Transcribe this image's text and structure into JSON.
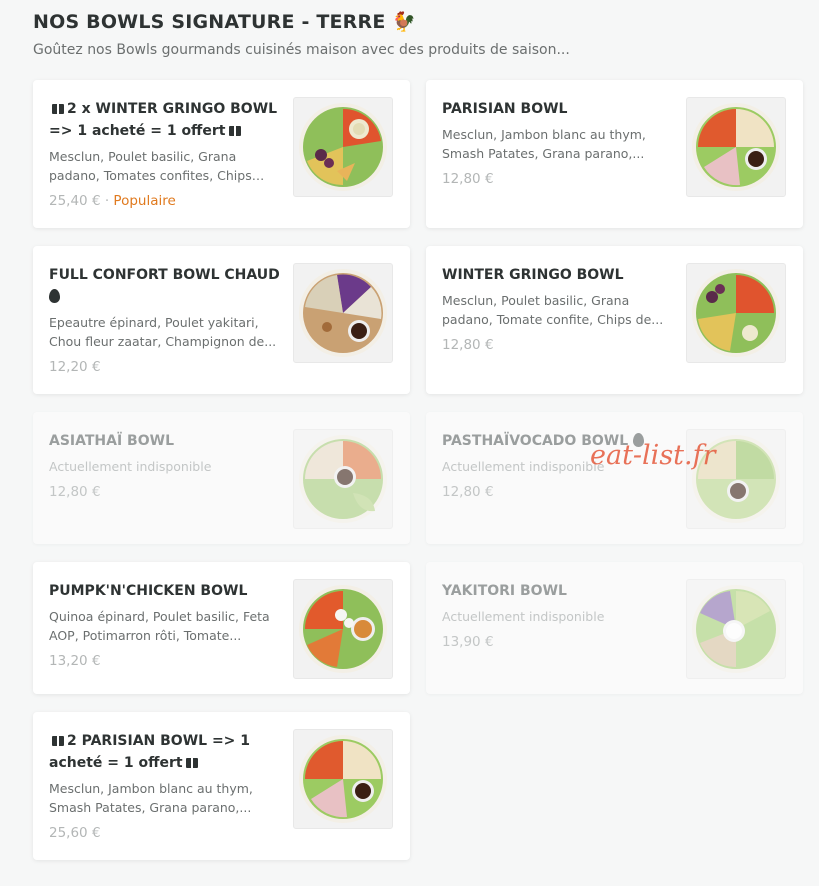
{
  "section": {
    "title": "NOS BOWLS SIGNATURE - TERRE 🐓",
    "subtitle": "Goûtez nos Bowls gourmands cuisinés maison avec des produits de saison..."
  },
  "watermark": "eat-list.fr",
  "items": [
    {
      "name": "2 x WINTER GRINGO BOWL => 1 acheté = 1 offert",
      "description": "Mesclun, Poulet basilic, Grana padano, Tomates confites, Chips de...",
      "price": "25,40 €",
      "badge": "Populaire",
      "available": true
    },
    {
      "name": "PARISIAN BOWL",
      "description": "Mesclun, Jambon blanc au thym, Smash Patates, Grana parano,...",
      "price": "12,80 €",
      "available": true
    },
    {
      "name": "FULL CONFORT BOWL CHAUD",
      "description": "Epeautre épinard, Poulet yakitari, Chou fleur zaatar, Champignon de...",
      "price": "12,20 €",
      "available": true
    },
    {
      "name": "WINTER GRINGO BOWL",
      "description": "Mesclun, Poulet basilic, Grana padano, Tomate confite, Chips de...",
      "price": "12,80 €",
      "available": true
    },
    {
      "name": "ASIATHAÏ BOWL",
      "description": "Actuellement indisponible",
      "price": "12,80 €",
      "available": false
    },
    {
      "name": "PASTHAÏVOCADO BOWL",
      "description": "Actuellement indisponible",
      "price": "12,80 €",
      "available": false
    },
    {
      "name": "PUMPK'N'CHICKEN BOWL",
      "description": "Quinoa épinard, Poulet basilic, Feta AOP, Potimarron rôti, Tomate...",
      "price": "13,20 €",
      "available": true
    },
    {
      "name": "YAKITORI BOWL",
      "description": "Actuellement indisponible",
      "price": "13,90 €",
      "available": false
    },
    {
      "name": "2 PARISIAN BOWL => 1 acheté = 1 offert",
      "description": "Mesclun, Jambon blanc au thym, Smash Patates, Grana parano,...",
      "price": "25,60 €",
      "available": true
    }
  ],
  "colors": {
    "background": "#f6f7f7",
    "card": "#ffffff",
    "text": "#2e3333",
    "muted": "#6b6f6f",
    "popular": "#e07a1f",
    "watermark": "#e55a3c"
  }
}
